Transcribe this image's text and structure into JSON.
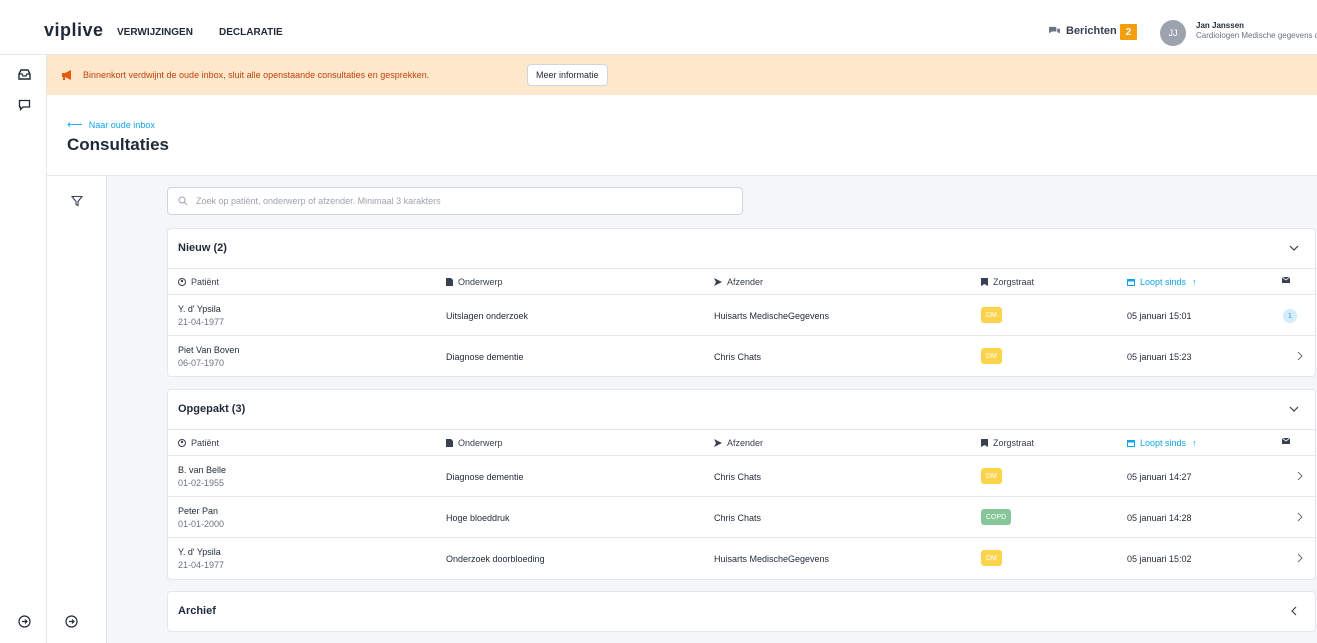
{
  "header": {
    "logo": "viplive",
    "nav": [
      "VERWIJZINGEN",
      "DECLARATIE"
    ],
    "messages_label": "Berichten",
    "messages_count": "2",
    "user_initials": "JJ",
    "user_name": "Jan Janssen",
    "user_org": "Cardiologen Medische gegevens dienst"
  },
  "banner": {
    "text": "Binnenkort verdwijnt de oude inbox, sluit alle openstaande consultaties en gesprekken.",
    "button": "Meer informatie"
  },
  "page": {
    "back_link": "Naar oude inbox",
    "title": "Consultaties"
  },
  "search": {
    "placeholder": "Zoek op patiënt, onderwerp of afzender. Minimaal 3 karakters"
  },
  "columns": {
    "patient": "Patiënt",
    "onderwerp": "Onderwerp",
    "afzender": "Afzender",
    "zorgstraat": "Zorgstraat",
    "loopt_sinds": "Loopt sinds"
  },
  "sections": {
    "nieuw": {
      "title": "Nieuw (2)",
      "rows": [
        {
          "name": "Y. d' Ypsila",
          "dob": "21-04-1977",
          "subject": "Uitslagen onderzoek",
          "sender": "Huisarts MedischeGegevens",
          "tag": "DM",
          "since": "05 januari 15:01",
          "count": "1"
        },
        {
          "name": "Piet Van Boven",
          "dob": "06-07-1970",
          "subject": "Diagnose dementie",
          "sender": "Chris Chats",
          "tag": "DM",
          "since": "05 januari 15:23"
        }
      ]
    },
    "opgepakt": {
      "title": "Opgepakt (3)",
      "rows": [
        {
          "name": "B. van Belle",
          "dob": "01-02-1955",
          "subject": "Diagnose dementie",
          "sender": "Chris Chats",
          "tag": "DM",
          "since": "05 januari 14:27"
        },
        {
          "name": "Peter Pan",
          "dob": "01-01-2000",
          "subject": "Hoge bloeddruk",
          "sender": "Chris Chats",
          "tag": "COPD",
          "since": "05 januari 14:28"
        },
        {
          "name": "Y. d' Ypsila",
          "dob": "21-04-1977",
          "subject": "Onderzoek doorbloeding",
          "sender": "Huisarts MedischeGegevens",
          "tag": "DM",
          "since": "05 januari 15:02"
        }
      ]
    },
    "archief": {
      "title": "Archief"
    }
  },
  "colors": {
    "accent": "#0ea5e9",
    "banner_bg": "#fde8cc",
    "banner_text": "#c2410c",
    "badge": "#f59e0b",
    "tag_dm": "#fcd34d",
    "tag_copd": "#86c79a"
  },
  "icons": {
    "inbox": "inbox-icon",
    "chat": "chat-bubble-icon",
    "filter": "filter-icon",
    "logout": "logout-icon",
    "megaphone": "megaphone-icon",
    "search": "search-icon",
    "patient": "user-circle-icon",
    "subject": "document-icon",
    "sender": "send-icon",
    "care": "bookmark-icon",
    "calendar": "calendar-icon",
    "mail": "mail-icon",
    "chevron_down": "chevron-down-icon",
    "chevron_right": "chevron-right-icon",
    "chevron_left": "chevron-left-icon"
  }
}
